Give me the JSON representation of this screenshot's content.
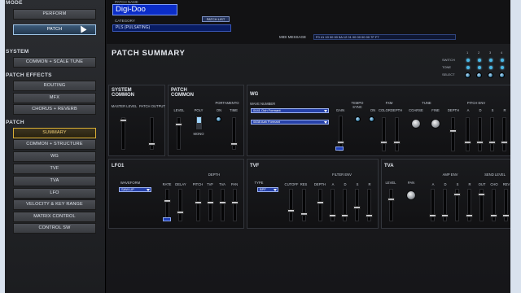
{
  "sidebar": {
    "mode_title": "MODE",
    "mode_buttons": [
      "PERFORM",
      "PATCH"
    ],
    "system_title": "SYSTEM",
    "system_buttons": [
      "COMMON + SCALE TUNE"
    ],
    "patch_effects_title": "PATCH EFFECTS",
    "patch_effects_buttons": [
      "ROUTING",
      "MFX",
      "CHORUS + REVERB"
    ],
    "patch_title": "PATCH",
    "patch_buttons": [
      "SUMMARY",
      "COMMON + STRUCTURE",
      "WG",
      "TVF",
      "TVA",
      "LFO",
      "VELOCITY & KEY RANGE",
      "MATRIX CONTROL",
      "CONTROL SW"
    ]
  },
  "header": {
    "patch_label": "PATCH NAME",
    "patch_name": "Digi-Doo",
    "patch_list": "PATCH LIST",
    "category_label": "CATEGORY",
    "category_value": "PLS (PULSATING)",
    "midi_label": "MIDI MESSAGE",
    "midi_value": "F0 41 10 00 00 5A 12 01 00 00 00 00 7F F7"
  },
  "summary": {
    "title": "PATCH SUMMARY",
    "switch_labels": [
      "SWITCH",
      "TONE",
      "SELECT"
    ],
    "switch_numbers": [
      "1",
      "2",
      "3",
      "4"
    ]
  },
  "blocks": {
    "system_common": {
      "title": "SYSTEM COMMON",
      "labels": [
        "MASTER LEVEL",
        "PATCH OUTPUT"
      ]
    },
    "patch_common": {
      "title": "PATCH COMMON",
      "labels": [
        "LEVEL",
        "POLY",
        "MONO",
        "PORTAMENTO",
        "ON",
        "TIME"
      ]
    },
    "wg": {
      "title": "WG",
      "wave_label": "WAVE NUMBER",
      "wave1": "0441 Ooh Formant",
      "wave2": "0838 Aah Formant",
      "labels": [
        "GAIN",
        "TEMPO SYNC",
        "ON",
        "FXM",
        "COLOR",
        "DEPTH",
        "TUNE",
        "COARSE",
        "FINE",
        "PITCH ENV",
        "DEPTH",
        "A",
        "D",
        "S",
        "R"
      ]
    },
    "lfo1": {
      "title": "LFO1",
      "waveform_label": "WAVEFORM",
      "waveform": "SAW-UP",
      "labels": [
        "RATE",
        "DELAY",
        "DEPTH",
        "PITCH",
        "TVF",
        "TVA",
        "PAN"
      ]
    },
    "tvf": {
      "title": "TVF",
      "type_label": "TYPE",
      "type": "BPF",
      "labels": [
        "CUTOFF",
        "RES",
        "FILTER ENV",
        "DEPTH",
        "A",
        "D",
        "S",
        "R"
      ]
    },
    "tva": {
      "title": "TVA",
      "labels": [
        "LEVEL",
        "PAN",
        "AMP ENV",
        "A",
        "D",
        "S",
        "R",
        "SEND LEVEL",
        "OUT",
        "CHO",
        "REV"
      ]
    }
  },
  "colors": {
    "accent_blue": "#2641a8",
    "summary_gold": "#d9ae35",
    "led_blue": "#49b8e6"
  }
}
